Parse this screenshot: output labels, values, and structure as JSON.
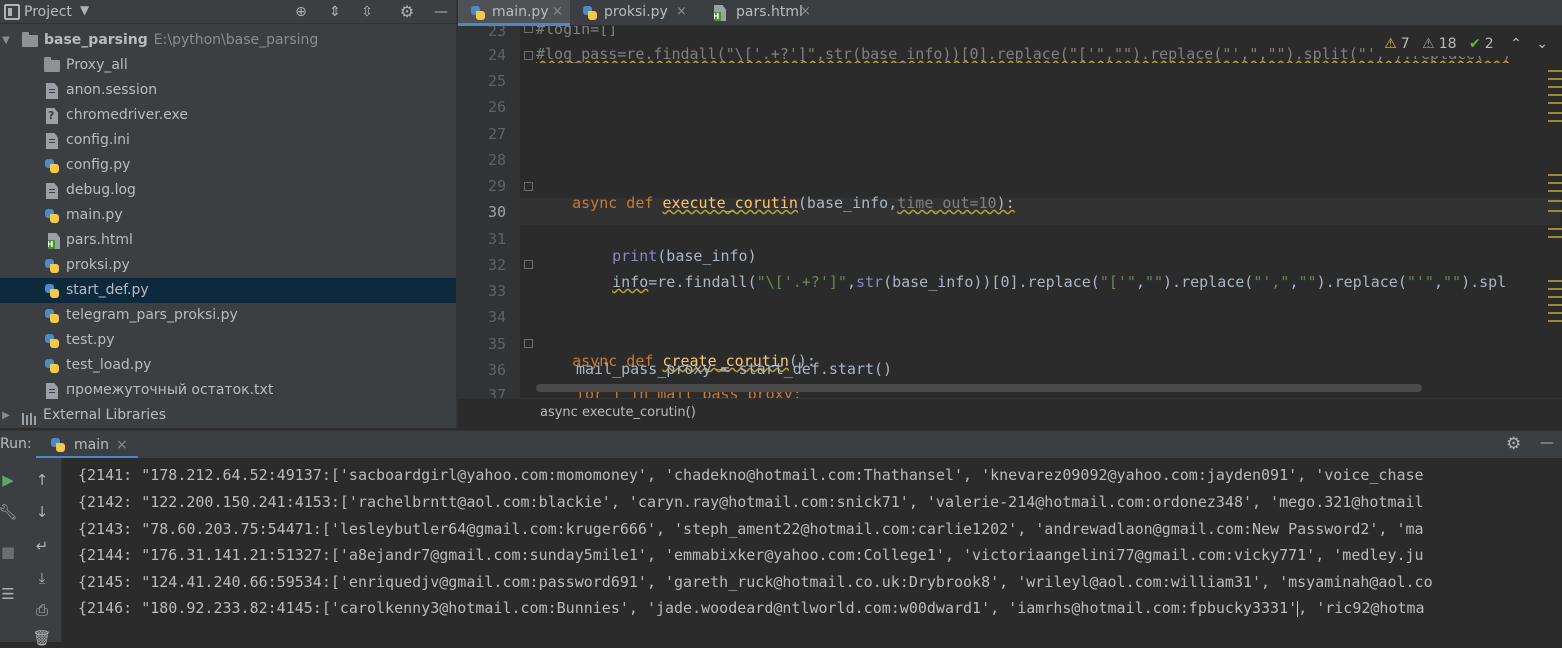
{
  "project": {
    "title": "Project",
    "root": {
      "name": "base_parsing",
      "path": "E:\\python\\base_parsing"
    },
    "items": [
      {
        "name": "Proxy_all",
        "type": "folder"
      },
      {
        "name": "anon.session",
        "type": "file"
      },
      {
        "name": "chromedriver.exe",
        "type": "exe"
      },
      {
        "name": "config.ini",
        "type": "file"
      },
      {
        "name": "config.py",
        "type": "py"
      },
      {
        "name": "debug.log",
        "type": "file"
      },
      {
        "name": "main.py",
        "type": "py"
      },
      {
        "name": "pars.html",
        "type": "html"
      },
      {
        "name": "proksi.py",
        "type": "py"
      },
      {
        "name": "start_def.py",
        "type": "py",
        "selected": true
      },
      {
        "name": "telegram_pars_proksi.py",
        "type": "py"
      },
      {
        "name": "test.py",
        "type": "py"
      },
      {
        "name": "test_load.py",
        "type": "py"
      },
      {
        "name": "промежуточный остаток.txt",
        "type": "file"
      }
    ],
    "external": "External Libraries"
  },
  "tabs": [
    {
      "label": "main.py",
      "type": "py",
      "active": true
    },
    {
      "label": "proksi.py",
      "type": "py"
    },
    {
      "label": "pars.html",
      "type": "html"
    }
  ],
  "inspections": {
    "warnings": "7",
    "weak_warnings": "18",
    "ok": "2"
  },
  "editor": {
    "line_numbers": [
      "23",
      "24",
      "25",
      "26",
      "27",
      "28",
      "29",
      "30",
      "31",
      "32",
      "33",
      "34",
      "35",
      "36",
      "37"
    ],
    "current_line": "30",
    "code": {
      "l23": "#login=[]",
      "l24": "#log_pass=re.findall(\"\\['.+?']\",str(base_info))[0].replace(\"['\",\"\").replace(\"',\",\"\").split(\"',\").replace(\"\")",
      "l29_kw": "async def ",
      "l29_fn": "execute_corutin",
      "l29_a": "(base_info,",
      "l29_p": "time_out=10",
      "l29_b": "):",
      "l31_bi": "print",
      "l31_rest": "(base_info)",
      "l32_a": "info",
      "l32_b": "=re.findall(",
      "l32_s1": "\"\\['.+?']\"",
      "l32_c": ",",
      "l32_bi": "str",
      "l32_d": "(base_info))[0].replace(",
      "l32_s2": "\"['\"",
      "l32_e": ",",
      "l32_s3": "\"\"",
      "l32_f": ").replace(",
      "l32_s4": "\"',\"",
      "l32_g": ",",
      "l32_s5": "\"\"",
      "l32_h": ").replace(",
      "l32_s6": "\"'\"",
      "l32_i": ",",
      "l32_s7": "\"\"",
      "l32_j": ").spl",
      "l35_kw": "async def ",
      "l35_fn": "create_corutin",
      "l35_rest": "():",
      "l36": "mail_pass_proxy = start_def.start()",
      "l37": "for i in mail_pass_proxy:"
    },
    "breadcrumb": "async execute_corutin()"
  },
  "run": {
    "label": "Run:",
    "tab": "main",
    "lines": [
      "{2141: \"178.212.64.52:49137:['sacboardgirl@yahoo.com:momomoney', 'chadekno@hotmail.com:Thathansel', 'knevarez09092@yahoo.com:jayden091', 'voice_chase",
      "{2142: \"122.200.150.241:4153:['rachelbrntt@aol.com:blackie', 'caryn.ray@hotmail.com:snick71', 'valerie-214@hotmail.com:ordonez348', 'mego.321@hotmail",
      "{2143: \"78.60.203.75:54471:['lesleybutler64@gmail.com:kruger666', 'steph_ament22@hotmail.com:carlie1202', 'andrewadlaon@gmail.com:New Password2', 'ma",
      "{2144: \"176.31.141.21:51327:['a8ejandr7@gmail.com:sunday5mile1', 'emmabixker@yahoo.com:College1', 'victoriaangelini77@gmail.com:vicky771', 'medley.ju",
      "{2145: \"124.41.240.66:59534:['enriquedjv@gmail.com:password691', 'gareth_ruck@hotmail.co.uk:Drybrook8', 'wrileyl@aol.com:william31', 'msyaminah@aol.co",
      "{2146: \"180.92.233.82:4145:['carolkenny3@hotmail.com:Bunnies', 'jade.woodeard@ntlworld.com:w00dward1', 'iamrhs@hotmail.com:fpbucky3331'",
      ", 'ric92@hotma"
    ]
  }
}
